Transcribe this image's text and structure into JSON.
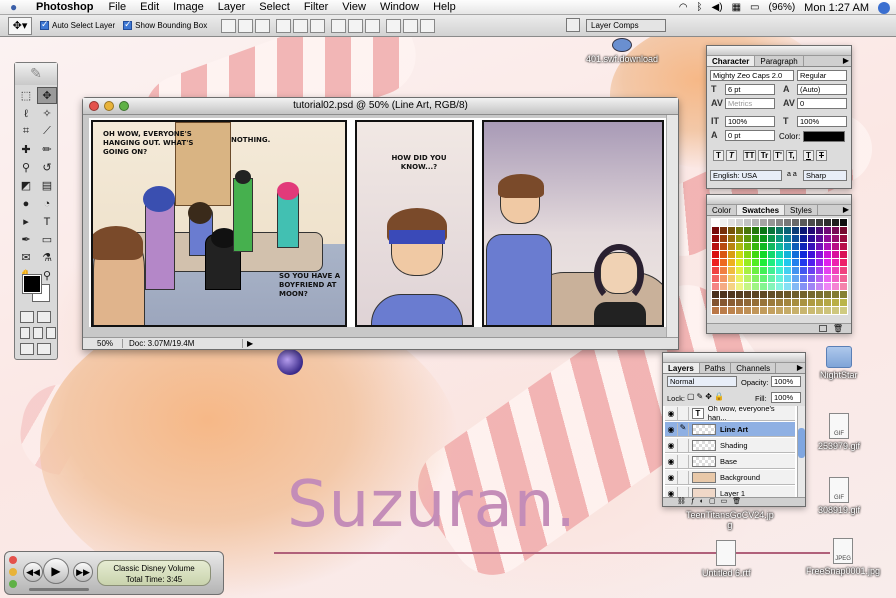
{
  "menubar": {
    "app_name": "Photoshop",
    "items": [
      "File",
      "Edit",
      "Image",
      "Layer",
      "Select",
      "Filter",
      "View",
      "Window",
      "Help"
    ],
    "battery": "(96%)",
    "clock": "Mon 1:27 AM"
  },
  "options": {
    "auto_select_label": "Auto Select Layer",
    "auto_select_checked": true,
    "bounding_box_label": "Show Bounding Box",
    "bounding_box_checked": true,
    "layer_comps_label": "Layer Comps"
  },
  "document": {
    "title": "tutorial02.psd @ 50% (Line Art, RGB/8)",
    "zoom": "50%",
    "doc_size": "Doc: 3.07M/19.4M",
    "bubbles": {
      "p1_a": "OH WOW, EVERYONE'S HANGING OUT. WHAT'S GOING ON?",
      "p1_b": "NOTHING.",
      "p1_c": "SO YOU HAVE A BOYFRIEND AT MOON?",
      "p2": "HOW DID YOU KNOW...?"
    }
  },
  "character": {
    "tabs": [
      "Character",
      "Paragraph"
    ],
    "font_family": "Mighty Zeo Caps 2.0",
    "font_style": "Regular",
    "font_size": "6 pt",
    "leading": "(Auto)",
    "kerning": "Metrics",
    "tracking": "0",
    "vscale": "100%",
    "hscale": "100%",
    "baseline": "0 pt",
    "color_label": "Color:",
    "style_buttons": [
      "T",
      "T",
      "TT",
      "Tr",
      "T'",
      "T,",
      "T",
      "T"
    ],
    "language": "English: USA",
    "aa_label": "a a",
    "antialias": "Sharp"
  },
  "swatches": {
    "tabs": [
      "Color",
      "Swatches",
      "Styles"
    ]
  },
  "layers": {
    "tabs": [
      "Layers",
      "Paths",
      "Channels"
    ],
    "blend_mode": "Normal",
    "opacity_label": "Opacity:",
    "opacity": "100%",
    "lock_label": "Lock:",
    "fill_label": "Fill:",
    "fill": "100%",
    "rows": [
      {
        "name": "Oh wow, everyone's han...",
        "thumb": "T"
      },
      {
        "name": "Line Art",
        "thumb": ""
      },
      {
        "name": "Shading",
        "thumb": ""
      },
      {
        "name": "Base",
        "thumb": ""
      },
      {
        "name": "Background",
        "thumb": ""
      },
      {
        "name": "Layer 1",
        "thumb": ""
      }
    ]
  },
  "desktop": {
    "icons": {
      "swf": "401.swf.download",
      "nightstar": "NightStar",
      "gif1": "253979.gif",
      "gif2": "308919.gif",
      "teen": "TeenTitansGoCV24.jp",
      "teen2": "g",
      "rtf": "Untitled 6.rtf",
      "jpeg": "FreeSnap0001.jpg"
    },
    "brand": "Suzuran."
  },
  "itunes": {
    "line1": "Classic Disney Volume",
    "line2": "Total Time: 3:45"
  }
}
